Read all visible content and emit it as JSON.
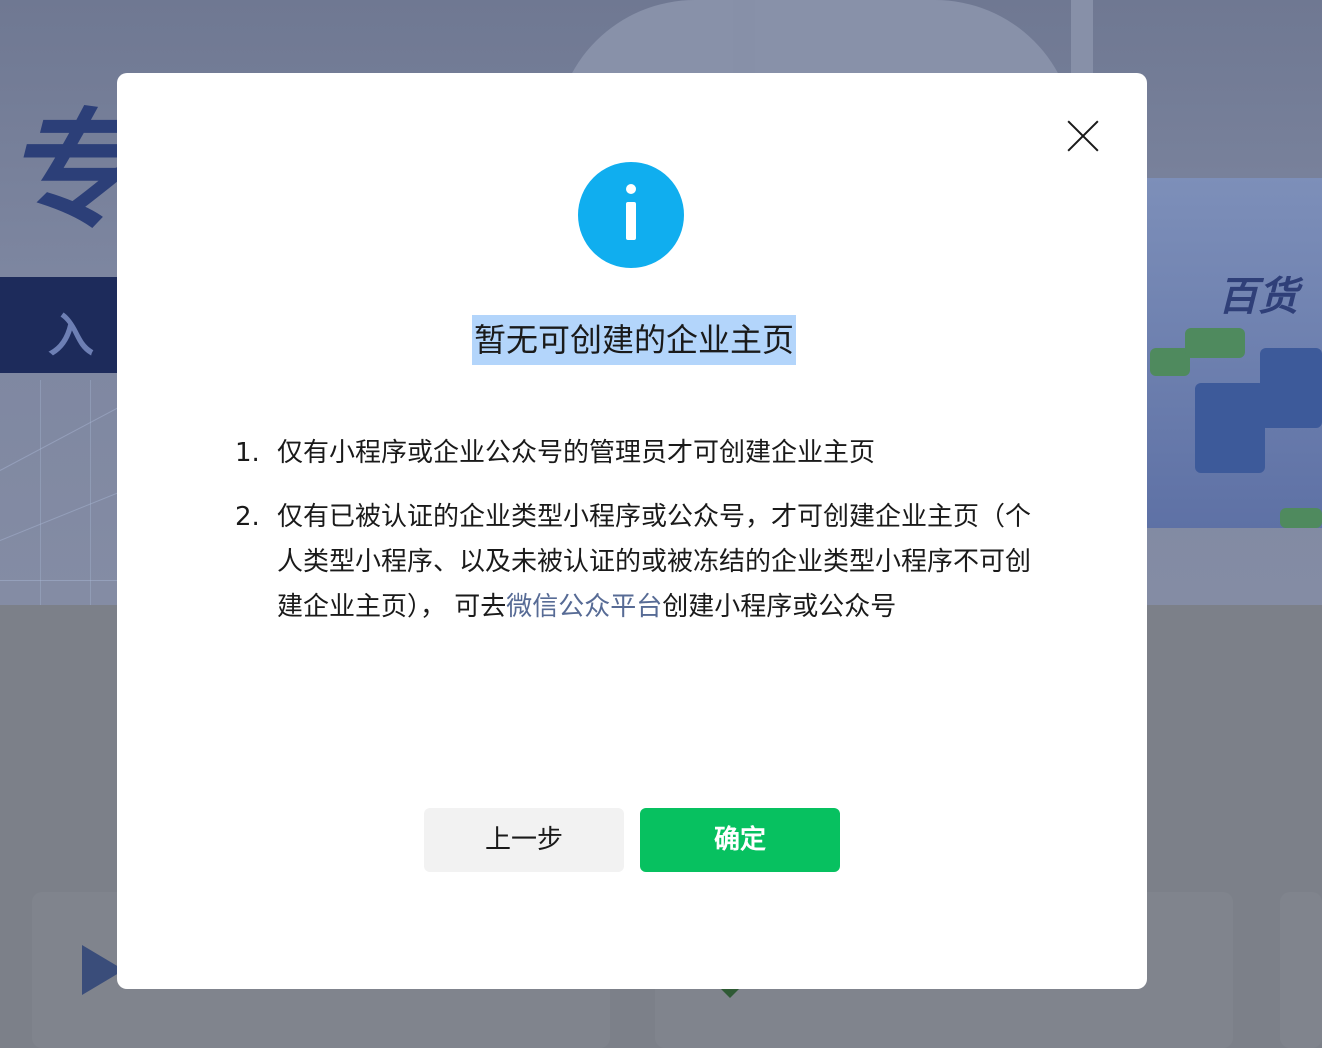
{
  "background": {
    "hero_glyph": "专",
    "hero_bar_text": "入",
    "right_label": "百货"
  },
  "modal": {
    "title": "暂无可创建的企业主页",
    "icon": "info-icon",
    "close_icon": "close-icon",
    "notes": [
      {
        "number": "1.",
        "text": "仅有小程序或企业公众号的管理员才可创建企业主页"
      },
      {
        "number": "2.",
        "text_before_link": "仅有已被认证的企业类型小程序或公众号，才可创建企业主页（个人类型小程序、以及未被认证的或被冻结的企业类型小程序不可创建企业主页），  可去",
        "link_text": "微信公众平台",
        "text_after_link": "创建小程序或公众号"
      }
    ],
    "buttons": {
      "prev_label": "上一步",
      "confirm_label": "确定"
    }
  },
  "colors": {
    "accent_green": "#07c160",
    "info_blue": "#10aeef",
    "link_blue": "#576b95",
    "selection_highlight": "#b3d5fb"
  }
}
